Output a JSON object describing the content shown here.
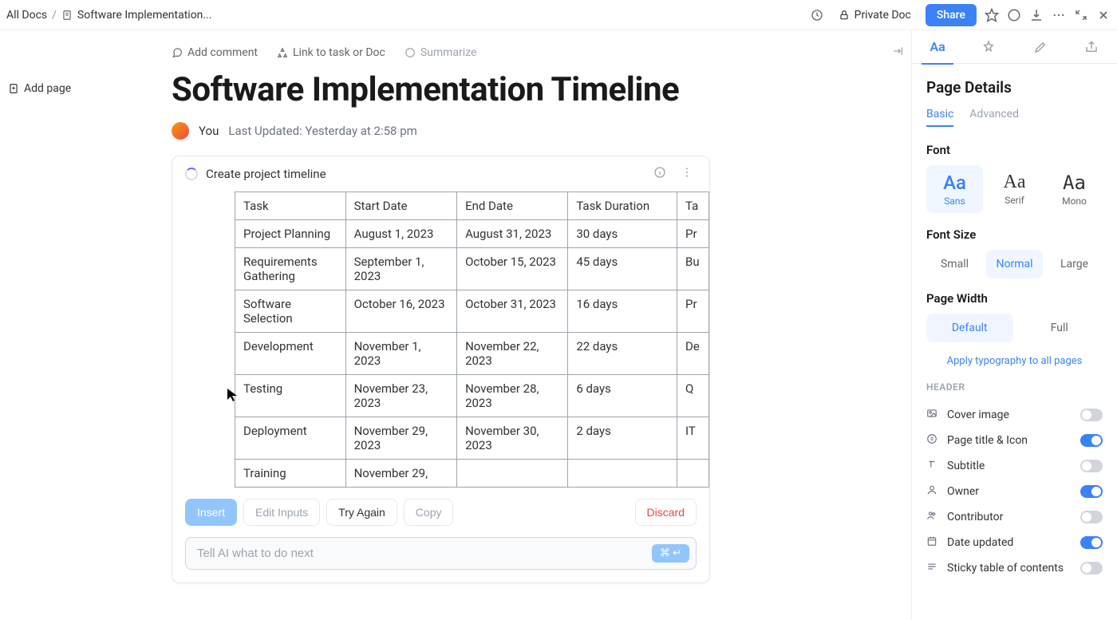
{
  "breadcrumb": {
    "root": "All Docs",
    "doc": "Software Implementation..."
  },
  "sidebar": {
    "add_page": "Add page"
  },
  "doc_actions": {
    "comment": "Add comment",
    "link": "Link to task or Doc",
    "summarize": "Summarize"
  },
  "doc": {
    "title": "Software Implementation Timeline",
    "author": "You",
    "updated": "Last Updated:  Yesterday at 2:58 pm"
  },
  "topbar": {
    "privacy": "Private Doc",
    "share": "Share"
  },
  "ai": {
    "prompt_title": "Create project timeline",
    "table": {
      "headers": [
        "Task",
        "Start Date",
        "End Date",
        "Task Duration",
        "Ta"
      ],
      "rows": [
        [
          "Project Planning",
          "August 1, 2023",
          "August 31, 2023",
          "30 days",
          "Pr"
        ],
        [
          "Requirements Gathering",
          "September 1, 2023",
          "October 15, 2023",
          "45 days",
          "Bu"
        ],
        [
          "Software Selection",
          "October 16, 2023",
          "October 31, 2023",
          "16 days",
          "Pr"
        ],
        [
          "Development",
          "November 1, 2023",
          "November 22, 2023",
          "22 days",
          "De"
        ],
        [
          "Testing",
          "November 23, 2023",
          "November 28, 2023",
          "6 days",
          "Q"
        ],
        [
          "Deployment",
          "November 29, 2023",
          "November 30, 2023",
          "2 days",
          "IT"
        ],
        [
          "Training",
          "November 29,",
          "",
          "",
          ""
        ]
      ]
    },
    "buttons": {
      "insert": "Insert",
      "edit": "Edit Inputs",
      "retry": "Try Again",
      "copy": "Copy",
      "discard": "Discard"
    },
    "input_placeholder": "Tell AI what to do next",
    "shortcut": "⌘ ↵"
  },
  "panel": {
    "title": "Page Details",
    "subtabs": {
      "basic": "Basic",
      "advanced": "Advanced"
    },
    "font": {
      "label": "Font",
      "sans": "Sans",
      "serif": "Serif",
      "mono": "Mono"
    },
    "font_size": {
      "label": "Font Size",
      "small": "Small",
      "normal": "Normal",
      "large": "Large"
    },
    "page_width": {
      "label": "Page Width",
      "default": "Default",
      "full": "Full"
    },
    "apply_all": "Apply typography to all pages",
    "header": {
      "label": "HEADER",
      "cover": "Cover image",
      "title_icon": "Page title & Icon",
      "subtitle": "Subtitle",
      "owner": "Owner",
      "contributor": "Contributor",
      "date_updated": "Date updated",
      "sticky_toc": "Sticky table of contents"
    }
  }
}
